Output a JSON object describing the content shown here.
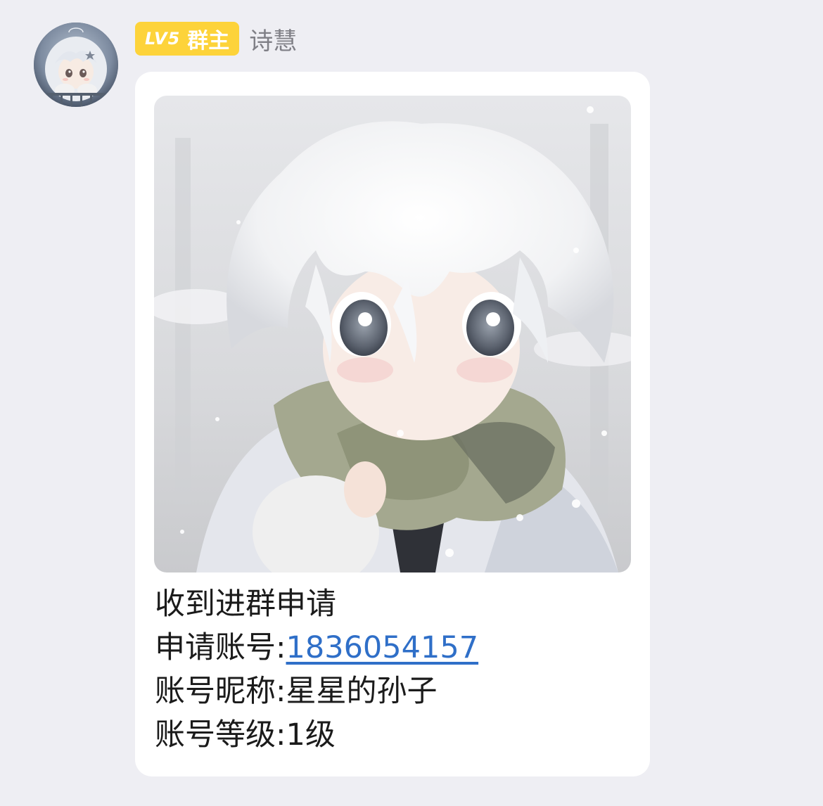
{
  "sender": {
    "badge_level": "LV5",
    "badge_role": "群主",
    "name": "诗慧"
  },
  "message": {
    "title": "收到进群申请",
    "account_label": "申请账号:",
    "account_value": "1836054157",
    "nickname_label": "账号昵称:",
    "nickname_value": "星星的孙子",
    "level_label": "账号等级:",
    "level_value": "1级"
  },
  "colors": {
    "badge_bg": "#fdd33a",
    "link": "#2f6fc8",
    "chat_bg": "#eeeef3"
  }
}
